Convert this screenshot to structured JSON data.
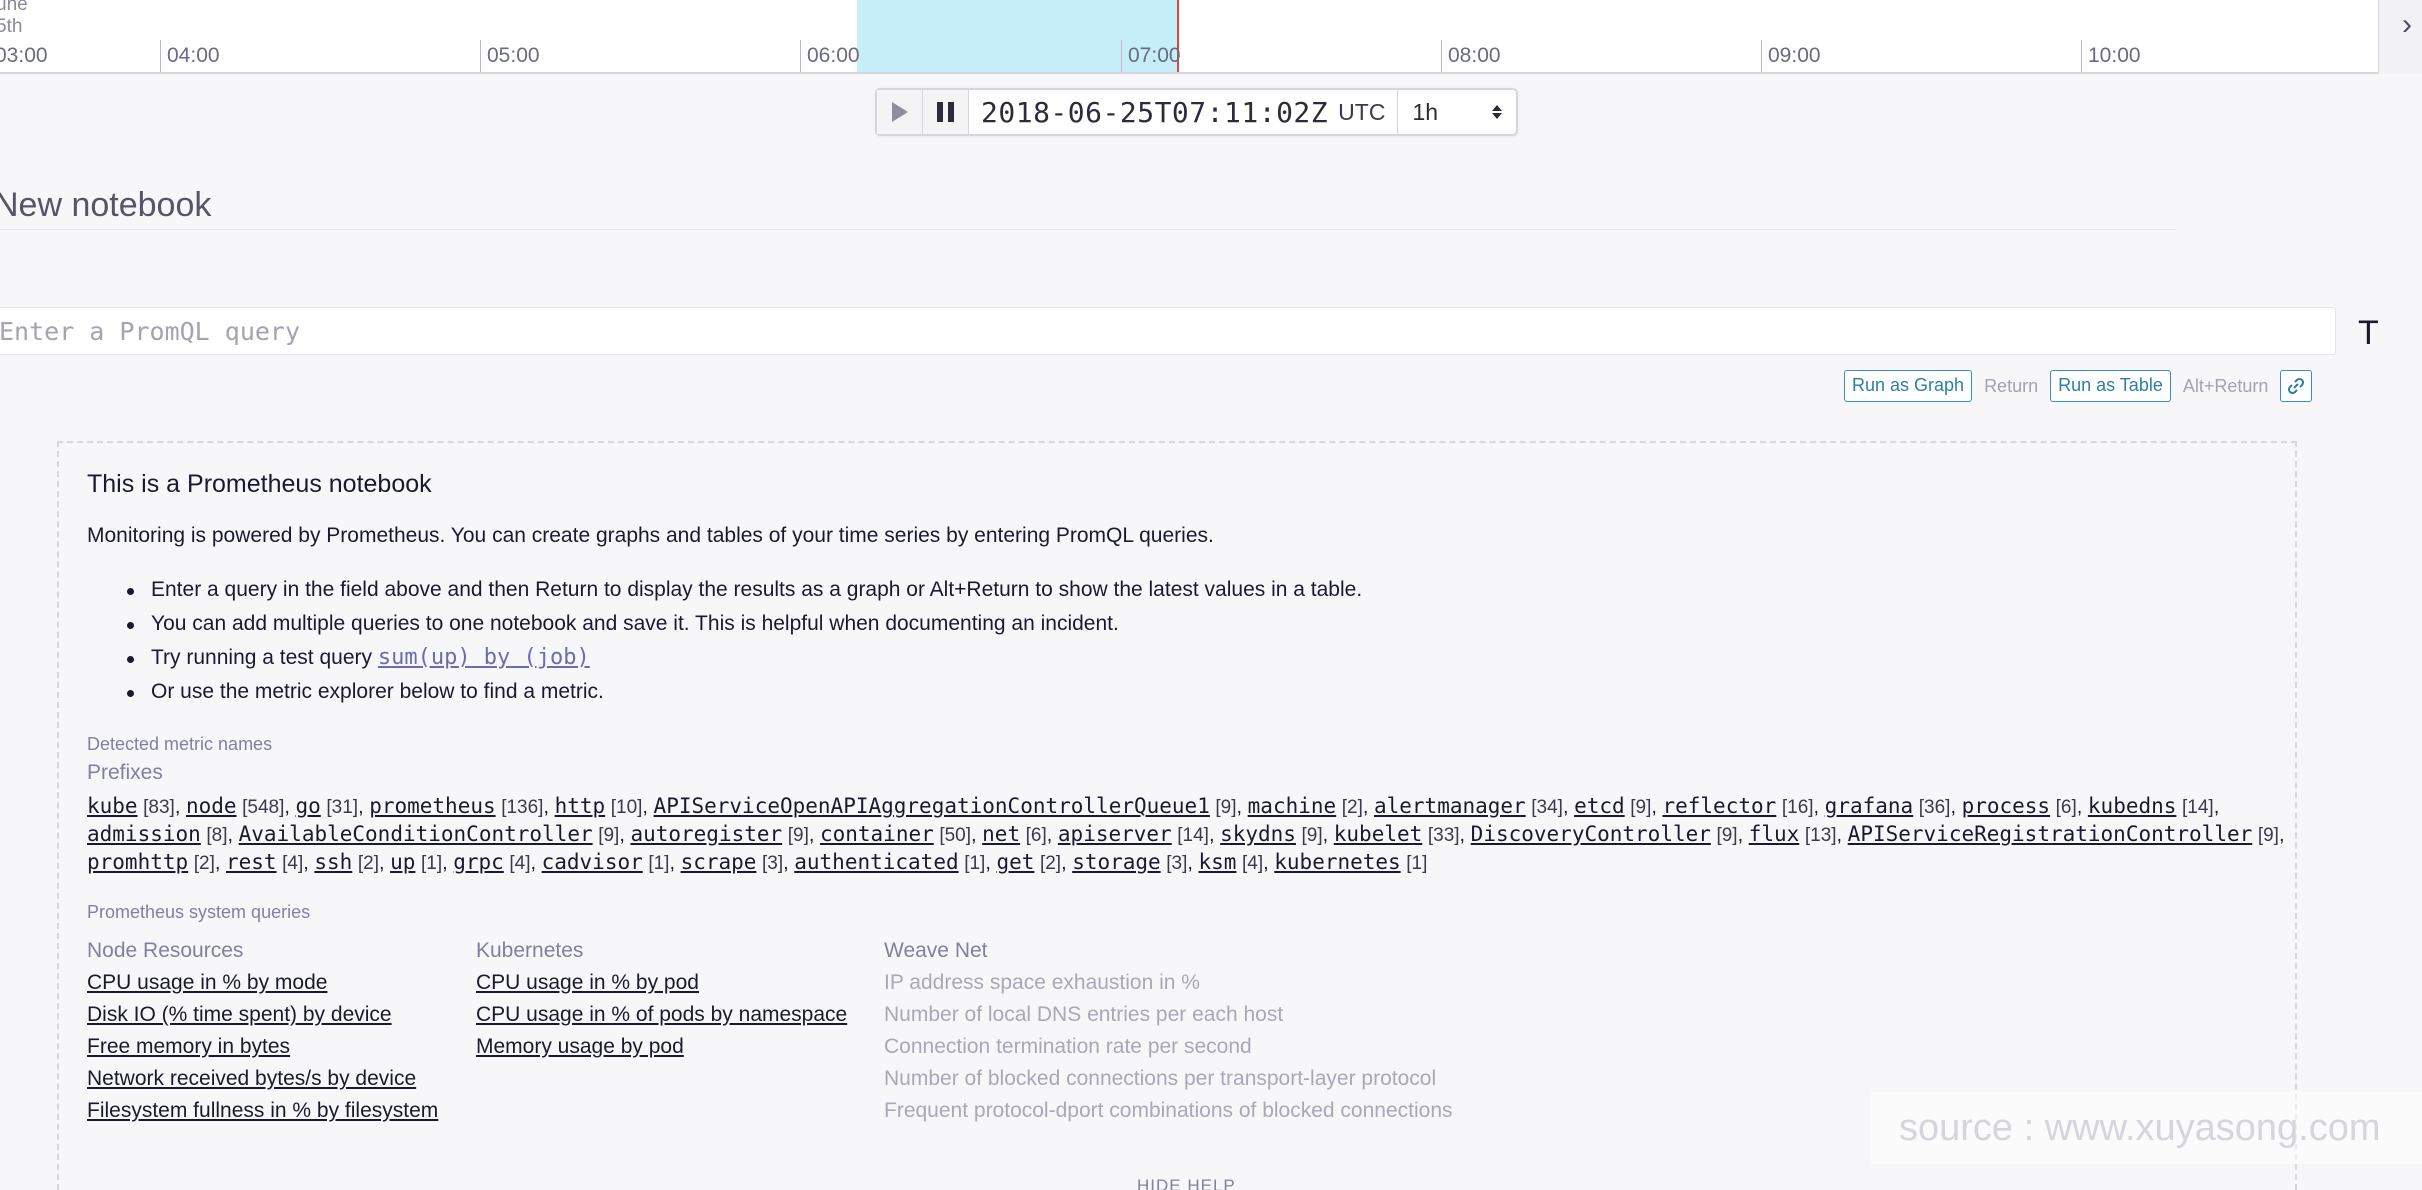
{
  "timeline": {
    "corner_top": "une",
    "corner_bottom": "5th",
    "ticks": [
      "03:00",
      "04:00",
      "05:00",
      "06:00",
      "07:00",
      "08:00",
      "09:00",
      "10:00"
    ]
  },
  "controls": {
    "timestamp": "2018-06-25T07:11:02Z",
    "timezone": "UTC",
    "range": "1h"
  },
  "notebook": {
    "title": "New notebook",
    "query_placeholder": "Enter a PromQL query",
    "query_value": "",
    "side_icon_glyph": "T",
    "run_graph_label": "Run as Graph",
    "run_graph_hint": "Return",
    "run_table_label": "Run as Table",
    "run_table_hint": "Alt+Return"
  },
  "help": {
    "title": "This is a Prometheus notebook",
    "intro": "Monitoring is powered by Prometheus. You can create graphs and tables of your time series by entering PromQL queries.",
    "bullets": [
      "Enter a query in the field above and then Return to display the results as a graph or Alt+Return to show the latest values in a table.",
      "You can add multiple queries to one notebook and save it. This is helpful when documenting an incident.",
      "Try running a test query",
      "Or use the metric explorer below to find a metric."
    ],
    "test_query": "sum(up) by (job)",
    "detected_label": "Detected metric names",
    "prefixes_label": "Prefixes",
    "prefixes": [
      {
        "name": "kube",
        "count": "[83]"
      },
      {
        "name": "node",
        "count": "[548]"
      },
      {
        "name": "go",
        "count": "[31]"
      },
      {
        "name": "prometheus",
        "count": "[136]"
      },
      {
        "name": "http",
        "count": "[10]"
      },
      {
        "name": "APIServiceOpenAPIAggregationControllerQueue1",
        "count": "[9]"
      },
      {
        "name": "machine",
        "count": "[2]"
      },
      {
        "name": "alertmanager",
        "count": "[34]"
      },
      {
        "name": "etcd",
        "count": "[9]"
      },
      {
        "name": "reflector",
        "count": "[16]"
      },
      {
        "name": "grafana",
        "count": "[36]"
      },
      {
        "name": "process",
        "count": "[6]"
      },
      {
        "name": "kubedns",
        "count": "[14]"
      },
      {
        "name": "admission",
        "count": "[8]"
      },
      {
        "name": "AvailableConditionController",
        "count": "[9]"
      },
      {
        "name": "autoregister",
        "count": "[9]"
      },
      {
        "name": "container",
        "count": "[50]"
      },
      {
        "name": "net",
        "count": "[6]"
      },
      {
        "name": "apiserver",
        "count": "[14]"
      },
      {
        "name": "skydns",
        "count": "[9]"
      },
      {
        "name": "kubelet",
        "count": "[33]"
      },
      {
        "name": "DiscoveryController",
        "count": "[9]"
      },
      {
        "name": "flux",
        "count": "[13]"
      },
      {
        "name": "APIServiceRegistrationController",
        "count": "[9]"
      },
      {
        "name": "promhttp",
        "count": "[2]"
      },
      {
        "name": "rest",
        "count": "[4]"
      },
      {
        "name": "ssh",
        "count": "[2]"
      },
      {
        "name": "up",
        "count": "[1]"
      },
      {
        "name": "grpc",
        "count": "[4]"
      },
      {
        "name": "cadvisor",
        "count": "[1]"
      },
      {
        "name": "scrape",
        "count": "[3]"
      },
      {
        "name": "authenticated",
        "count": "[1]"
      },
      {
        "name": "get",
        "count": "[2]"
      },
      {
        "name": "storage",
        "count": "[3]"
      },
      {
        "name": "ksm",
        "count": "[4]"
      },
      {
        "name": "kubernetes",
        "count": "[1]"
      }
    ],
    "system_label": "Prometheus system queries",
    "columns": [
      {
        "heading": "Node Resources",
        "enabled": true,
        "items": [
          "CPU usage in % by mode",
          "Disk IO (% time spent) by device",
          "Free memory in bytes",
          "Network received bytes/s by device",
          "Filesystem fullness in % by filesystem"
        ]
      },
      {
        "heading": "Kubernetes",
        "enabled": true,
        "items": [
          "CPU usage in % by pod",
          "CPU usage in % of pods by namespace",
          "Memory usage by pod"
        ]
      },
      {
        "heading": "Weave Net",
        "enabled": false,
        "items": [
          "IP address space exhaustion in %",
          "Number of local DNS entries per each host",
          "Connection termination rate per second",
          "Number of blocked connections per transport-layer protocol",
          "Frequent protocol-dport combinations of blocked connections"
        ]
      }
    ],
    "hide_label": "HIDE HELP"
  },
  "watermark": "source : www.xuyasong.com"
}
